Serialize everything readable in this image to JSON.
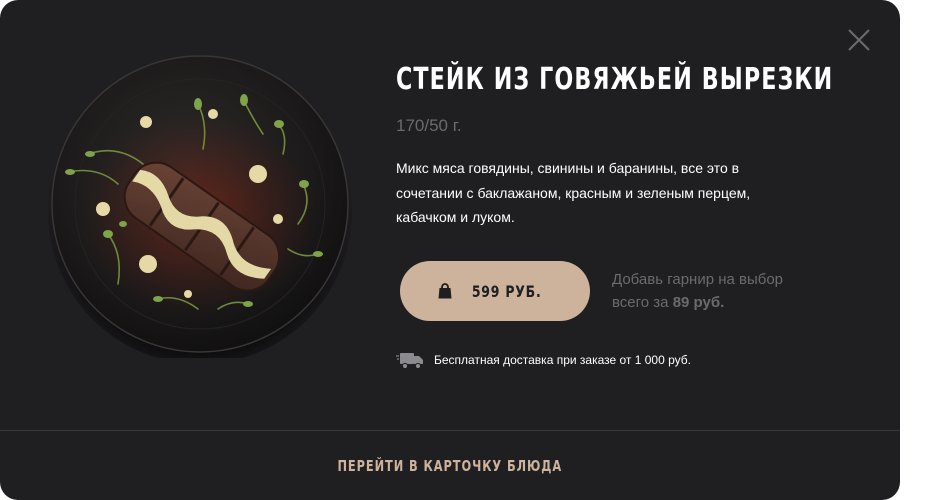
{
  "product": {
    "title": "СТЕЙК ИЗ ГОВЯЖЬЕЙ ВЫРЕЗКИ",
    "weight": "170/50 г.",
    "description": "Микс мяса говядины, свинины и баранины, все это в сочетании с баклажаном, красным и зеленым перцем, кабачком и луком."
  },
  "price_button": {
    "label": "599 РУБ.",
    "icon": "shopping-bag-icon"
  },
  "garnish": {
    "line1": "Добавь гарнир на выбор",
    "line2_prefix": "всего за ",
    "line2_price": "89 руб."
  },
  "delivery": {
    "icon": "delivery-truck-icon",
    "text": "Бесплатная доставка при заказе от 1 000 руб."
  },
  "footer": {
    "link_label": "ПЕРЕЙТИ В КАРТОЧКУ БЛЮДА"
  },
  "close": {
    "icon": "close-icon"
  },
  "colors": {
    "modal_background": "#1f1e21",
    "accent": "#cdb39c",
    "muted_text": "#6b6a6e",
    "divider": "#38373b"
  }
}
